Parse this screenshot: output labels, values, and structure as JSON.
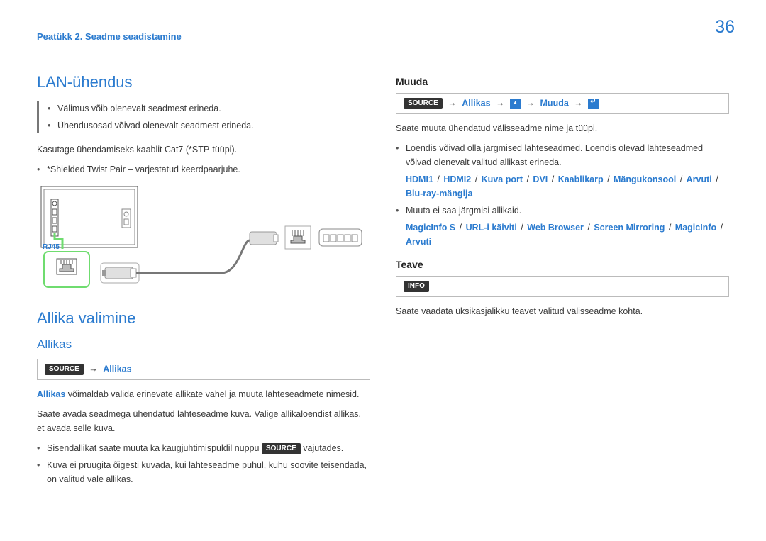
{
  "page_number": "36",
  "chapter": "Peatükk 2. Seadme seadistamine",
  "left": {
    "h_lan": "LAN-ühendus",
    "note1": "Välimus võib olenevalt seadmest erineda.",
    "note2": "Ühendusosad võivad olenevalt seadmest erineda.",
    "p1": "Kasutage ühendamiseks kaablit Cat7 (*STP-tüüpi).",
    "p1_sub": "*Shielded Twist Pair – varjestatud keerdpaarjuhe.",
    "rj45_label": "RJ45",
    "h_allika": "Allika valimine",
    "h_allikas": "Allikas",
    "path_allikas": "Allikas",
    "p2a": "võimaldab valida erinevate allikate vahel ja muuta lähteseadmete nimesid.",
    "p2b": "Saate avada seadmega ühendatud lähteseadme kuva. Valige allikaloendist allikas, et avada selle kuva.",
    "li1a": "Sisendallikat saate muuta ka kaugjuhtimispuldil nuppu",
    "li1b": "vajutades.",
    "li2": "Kuva ei pruugita õigesti kuvada, kui lähteseadme puhul, kuhu soovite teisendada, on valitud vale allikas."
  },
  "right": {
    "h_muuda": "Muuda",
    "path_muuda_allikas": "Allikas",
    "path_muuda_muuda": "Muuda",
    "p1": "Saate muuta ühendatud välisseadme nime ja tüüpi.",
    "li1": "Loendis võivad olla järgmised lähteseadmed. Loendis olevad lähteseadmed võivad olenevalt valitud allikast erineda.",
    "tok1": [
      "HDMI1",
      "HDMI2",
      "Kuva port",
      "DVI",
      "Kaablikarp",
      "Mängukonsool",
      "Arvuti",
      "Blu-ray-mängija"
    ],
    "li2": "Muuta ei saa järgmisi allikaid.",
    "tok2": [
      "MagicInfo S",
      "URL-i käiviti",
      "Web Browser",
      "Screen Mirroring",
      "MagicInfo",
      "Arvuti"
    ],
    "h_teave": "Teave",
    "p2": "Saate vaadata üksikasjalikku teavet valitud välisseadme kohta."
  },
  "labels": {
    "source": "SOURCE",
    "info": "INFO"
  }
}
